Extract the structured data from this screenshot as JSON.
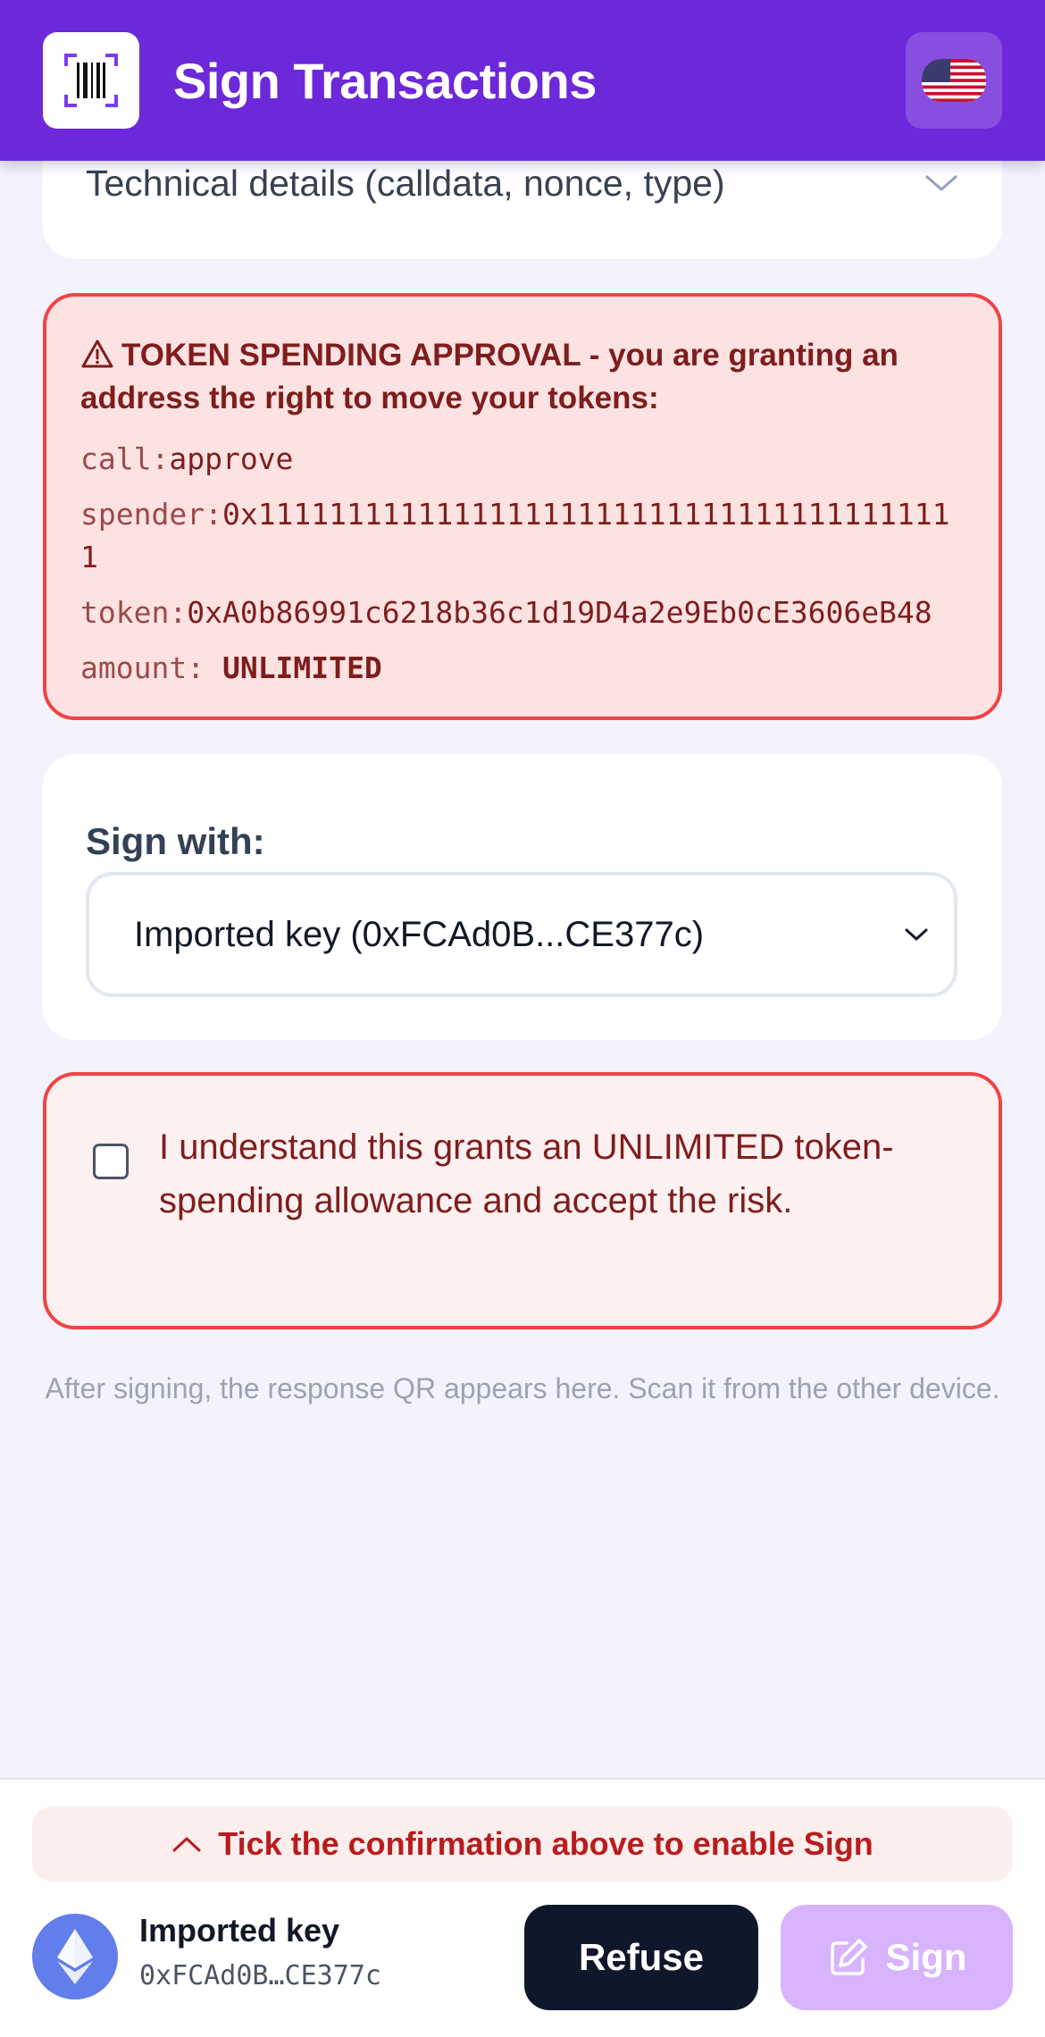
{
  "header": {
    "title": "Sign Transactions",
    "logo_icon": "qr-scanner-icon",
    "language_icon": "us-flag-icon"
  },
  "technical_details": {
    "label": "Technical details (calldata, nonce, type)"
  },
  "warning": {
    "heading": "TOKEN SPENDING APPROVAL - you are granting an address the right to move your tokens:",
    "call_key": "call:",
    "call_value": "approve",
    "spender_key": "spender:",
    "spender_value": "0x1111111111111111111111111111111111111111",
    "token_key": "token:",
    "token_value": "0xA0b86991c6218b36c1d19D4a2e9Eb0cE3606eB48",
    "amount_key": "amount:",
    "amount_value": "UNLIMITED"
  },
  "sign_with": {
    "label": "Sign with:",
    "selected": "Imported key (0xFCAd0B...CE377c)"
  },
  "confirmation": {
    "text": "I understand this grants an UNLIMITED token-spending allowance and accept the risk.",
    "checked": false
  },
  "info": {
    "text": "After signing, the response QR appears here. Scan it from the other device."
  },
  "bottom": {
    "hint": "Tick the confirmation above to enable Sign",
    "account_name": "Imported key",
    "account_address": "0xFCAd0B…CE377c",
    "refuse_label": "Refuse",
    "sign_label": "Sign"
  },
  "colors": {
    "brand": "#6d28d9",
    "danger": "#ef4444",
    "sign_disabled": "#d8b4fe"
  }
}
